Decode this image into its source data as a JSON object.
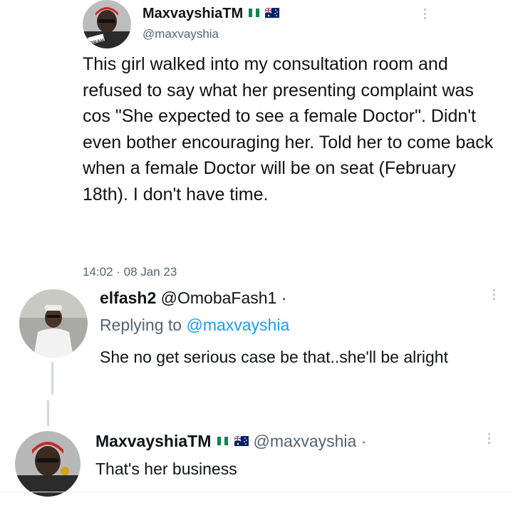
{
  "main_tweet": {
    "display_name": "MaxvayshiaTM",
    "handle": "@maxvayshia",
    "body": "This girl walked into my consultation room and refused to say what her presenting complaint was cos \"She expected to see a female Doctor\". Didn't even bother encouraging her. Told her to come back when a female Doctor will be on seat (February 18th). I don't have time.",
    "timestamp": "14:02 · 08 Jan 23",
    "avatar_text": "BRAH"
  },
  "reply_1": {
    "display_name": "elfash2",
    "handle": "@OmobaFash1 ·",
    "replying_prefix": "Replying to",
    "replying_handle": "@maxvayshia",
    "body": "She no get serious case be that..she'll be alright"
  },
  "reply_2": {
    "display_name": "MaxvayshiaTM",
    "handle": "@maxvayshia ·",
    "body": "That's her business"
  },
  "icons": {
    "more": "more-vertical-icon",
    "flag_1": "nigeria-flag",
    "flag_2": "australia-flag"
  },
  "colors": {
    "link": "#1d9bf0",
    "secondary_text": "#536471",
    "thread_line": "#cfd9de",
    "flag_green": "#008751",
    "flag_blue": "#012169"
  }
}
